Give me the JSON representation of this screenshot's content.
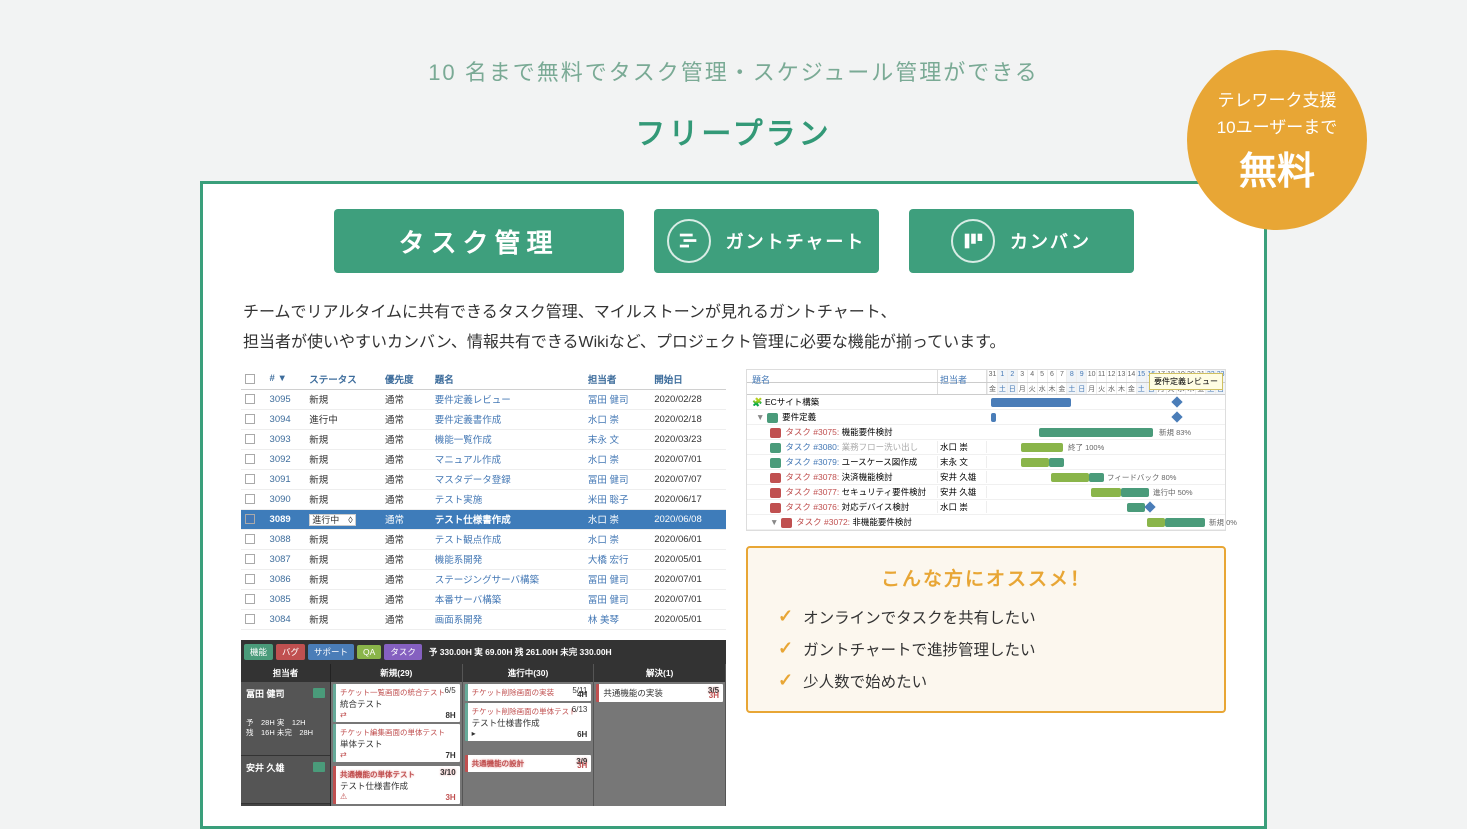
{
  "header": {
    "subtitle": "10 名まで無料でタスク管理・スケジュール管理ができる",
    "title": "フリープラン"
  },
  "badge": {
    "l1": "テレワーク支援",
    "l2": "10ユーザーまで",
    "l3": "無料"
  },
  "tabs": {
    "task": "タスク管理",
    "gantt": "ガントチャート",
    "kanban": "カンバン"
  },
  "desc1": "チームでリアルタイムに共有できるタスク管理、マイルストーンが見れるガントチャート、",
  "desc2": "担当者が使いやすいカンバン、情報共有できるWikiなど、プロジェクト管理に必要な機能が揃っています。",
  "table": {
    "cols": {
      "id": "#",
      "status": "ステータス",
      "priority": "優先度",
      "subject": "題名",
      "assignee": "担当者",
      "start": "開始日"
    },
    "rows": [
      {
        "id": "3095",
        "status": "新規",
        "priority": "通常",
        "subject": "要件定義レビュー",
        "assignee": "冨田 健司",
        "start": "2020/02/28"
      },
      {
        "id": "3094",
        "status": "進行中",
        "priority": "通常",
        "subject": "要件定義書作成",
        "assignee": "水口 崇",
        "start": "2020/02/18"
      },
      {
        "id": "3093",
        "status": "新規",
        "priority": "通常",
        "subject": "機能一覧作成",
        "assignee": "末永 文",
        "start": "2020/03/23"
      },
      {
        "id": "3092",
        "status": "新規",
        "priority": "通常",
        "subject": "マニュアル作成",
        "assignee": "水口 崇",
        "start": "2020/07/01"
      },
      {
        "id": "3091",
        "status": "新規",
        "priority": "通常",
        "subject": "マスタデータ登録",
        "assignee": "冨田 健司",
        "start": "2020/07/07"
      },
      {
        "id": "3090",
        "status": "新規",
        "priority": "通常",
        "subject": "テスト実施",
        "assignee": "米田 聡子",
        "start": "2020/06/17"
      },
      {
        "id": "3089",
        "status": "進行中",
        "priority": "通常",
        "subject": "テスト仕様書作成",
        "assignee": "水口 崇",
        "start": "2020/06/08",
        "sel": true
      },
      {
        "id": "3088",
        "status": "新規",
        "priority": "通常",
        "subject": "テスト観点作成",
        "assignee": "水口 崇",
        "start": "2020/06/01"
      },
      {
        "id": "3087",
        "status": "新規",
        "priority": "通常",
        "subject": "機能系開発",
        "assignee": "大橋 宏行",
        "start": "2020/05/01"
      },
      {
        "id": "3086",
        "status": "新規",
        "priority": "通常",
        "subject": "ステージングサーバ構築",
        "assignee": "冨田 健司",
        "start": "2020/07/01"
      },
      {
        "id": "3085",
        "status": "新規",
        "priority": "通常",
        "subject": "本番サーバ構築",
        "assignee": "冨田 健司",
        "start": "2020/07/01"
      },
      {
        "id": "3084",
        "status": "新規",
        "priority": "通常",
        "subject": "画面系開発",
        "assignee": "林 美琴",
        "start": "2020/05/01"
      }
    ]
  },
  "kanban": {
    "tags": {
      "feature": "機能",
      "bug": "バグ",
      "support": "サポート",
      "qa": "QA",
      "task": "タスク"
    },
    "stats": "予 330.00H 実 69.00H 残 261.00H 未完 330.00H",
    "cols": {
      "assignee": "担当者",
      "new": "新規(29)",
      "progress": "進行中(30)",
      "resolved": "解決(1)"
    },
    "assignees": [
      {
        "name": "冨田 健司",
        "st": "予　28H 実　12H",
        "st2": "残　16H 未完　28H"
      },
      {
        "name": "安井 久雄"
      }
    ],
    "cards": {
      "c1": {
        "title": "チケット一覧画面の統合テスト",
        "sub": "統合テスト",
        "pts": "6/5",
        "hrs": "8H"
      },
      "c2": {
        "title": "チケット編集画面の単体テスト",
        "sub": "単体テスト",
        "hrs": "7H"
      },
      "c3": {
        "title": "チケット削除画面の実装",
        "sub": "",
        "pts": "5/11",
        "hrs": "4H"
      },
      "c4": {
        "title": "チケット削除画面の単体テスト",
        "sub": "テスト仕様書作成",
        "pts": "6/13",
        "hrs": "6H"
      },
      "c5": {
        "title": "共通機能の実装",
        "pts": "3/5",
        "hrs": "3H"
      },
      "c6": {
        "title": "共通機能の単体テスト",
        "sub": "テスト仕様書作成",
        "pts": "3/10",
        "hrs": "3H"
      },
      "c7": {
        "title": "共通機能の設計",
        "pts": "3/9",
        "hrs": "3H"
      }
    }
  },
  "gantt": {
    "cols": {
      "subject": "題名",
      "assignee": "担当者"
    },
    "days": [
      "31",
      "1",
      "2",
      "3",
      "4",
      "5",
      "6",
      "7",
      "8",
      "9",
      "10",
      "11",
      "12",
      "13",
      "14",
      "15",
      "16",
      "17",
      "18",
      "19",
      "20",
      "21",
      "22",
      "23"
    ],
    "dow": [
      "金",
      "土",
      "日",
      "月",
      "火",
      "水",
      "木",
      "金",
      "土",
      "日",
      "月",
      "火",
      "水",
      "木",
      "金",
      "土",
      "日",
      "月",
      "火",
      "水",
      "木",
      "金",
      "土",
      "日"
    ],
    "tooltip": "要件定義レビュー",
    "rows": [
      {
        "s": "ECサイト構築",
        "icon": "p"
      },
      {
        "s": "要件定義",
        "icon": "v"
      },
      {
        "s": "タスク #3075: 機能要件検討",
        "icon": "t",
        "r": true,
        "a": "",
        "pct": "新規 83%"
      },
      {
        "s": "タスク #3080: 業務フロー洗い出し",
        "icon": "t",
        "r": false,
        "gray": true,
        "a": "水口 崇",
        "pct": "終了 100%"
      },
      {
        "s": "タスク #3079: ユースケース図作成",
        "icon": "t",
        "r": false,
        "a": "末永 文"
      },
      {
        "s": "タスク #3078: 決済機能検討",
        "icon": "t",
        "r": true,
        "a": "安井 久雄",
        "pct": "フィードバック 80%"
      },
      {
        "s": "タスク #3077: セキュリティ要件検討",
        "icon": "t",
        "r": true,
        "a": "安井 久雄",
        "pct": "進行中 50%"
      },
      {
        "s": "タスク #3076: 対応デバイス検討",
        "icon": "t",
        "r": true,
        "a": "水口 崇"
      },
      {
        "s": "タスク #3072: 非機能要件検討",
        "icon": "v",
        "r": true,
        "a": "",
        "pct": "新規 0%"
      }
    ]
  },
  "recommend": {
    "title": "こんな方にオススメ！",
    "items": [
      "オンラインでタスクを共有したい",
      "ガントチャートで進捗管理したい",
      "少人数で始めたい"
    ]
  }
}
